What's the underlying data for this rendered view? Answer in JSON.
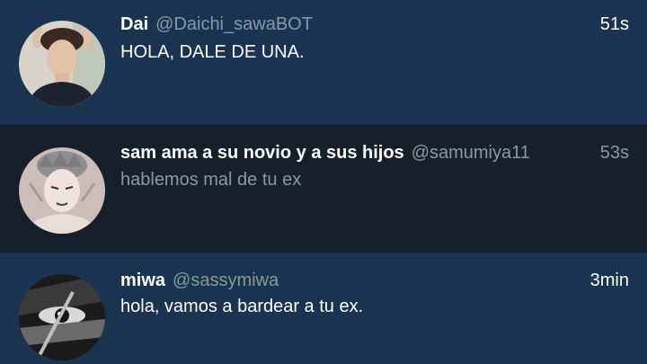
{
  "tweets": [
    {
      "name": "Dai",
      "handle": "@Daichi_sawaBOT",
      "time": "51s",
      "text": "HOLA, DALE DE UNA."
    },
    {
      "name": "sam ama a su novio y a sus hijos",
      "handle": "@samumiya11",
      "time": "53s",
      "text": "hablemos mal de tu ex"
    },
    {
      "name": "miwa",
      "handle": "@sassymiwa",
      "time": "3min",
      "text": "hola, vamos a bardear a tu ex."
    }
  ],
  "colors": {
    "highlight_bg": "#1a3350",
    "dim_bg": "#15202b",
    "primary_text": "#ffffff",
    "secondary_text": "#8899a6"
  }
}
